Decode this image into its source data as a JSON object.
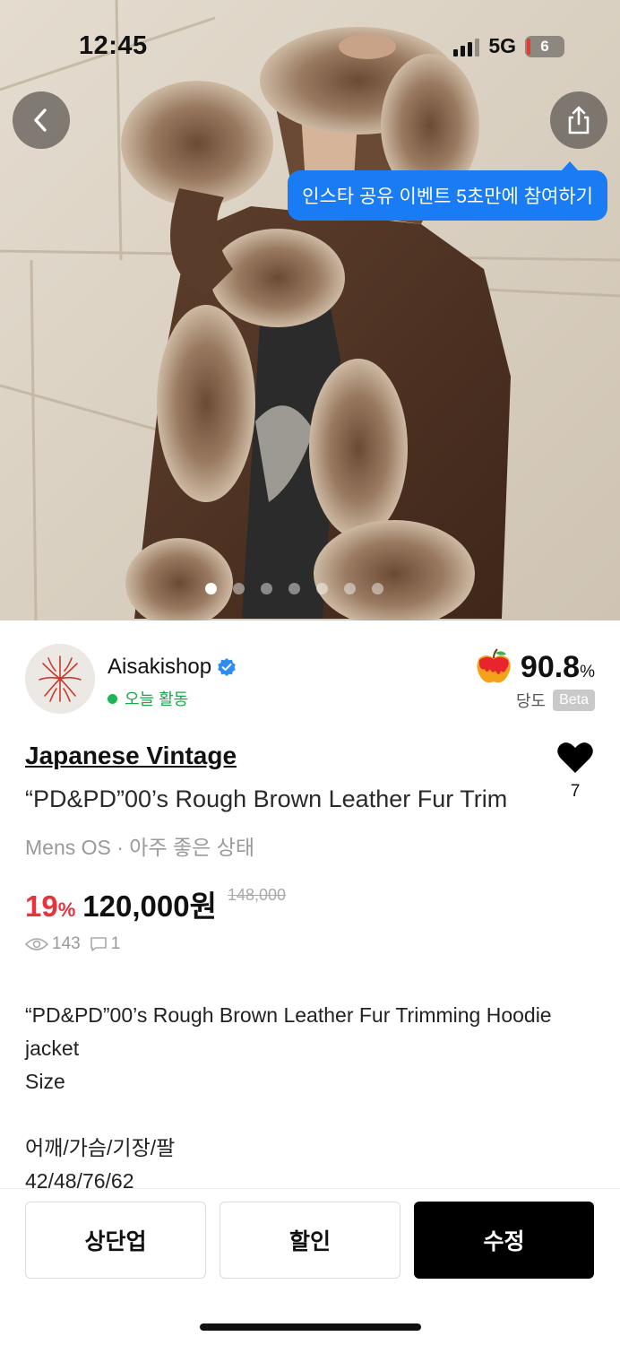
{
  "status_bar": {
    "time": "12:45",
    "network": "5G",
    "battery": "6"
  },
  "hero": {
    "share_tooltip": "인스타 공유 이벤트 5초만에 참여하기",
    "image_count": 8,
    "active_image_index": 0
  },
  "seller": {
    "name": "Aisakishop",
    "activity": "오늘 활동",
    "score": "90.8",
    "score_unit": "%",
    "score_label": "당도",
    "score_badge": "Beta"
  },
  "product": {
    "brand": "Japanese Vintage",
    "title": "“PD&PD”00’s Rough Brown Leather Fur Trim",
    "meta": "Mens OS · 아주 좋은 상태",
    "like_count": "7",
    "discount": "19",
    "discount_unit": "%",
    "price": "120,000원",
    "original_price": "148,000",
    "views": "143",
    "comments": "1",
    "description": [
      "“PD&PD”00’s Rough Brown Leather Fur Trimming Hoodie",
      "jacket",
      "Size",
      "",
      "어깨/가슴/기장/팔",
      "42/48/76/62"
    ]
  },
  "actions": {
    "bump": "상단업",
    "discount": "할인",
    "edit": "수정"
  }
}
